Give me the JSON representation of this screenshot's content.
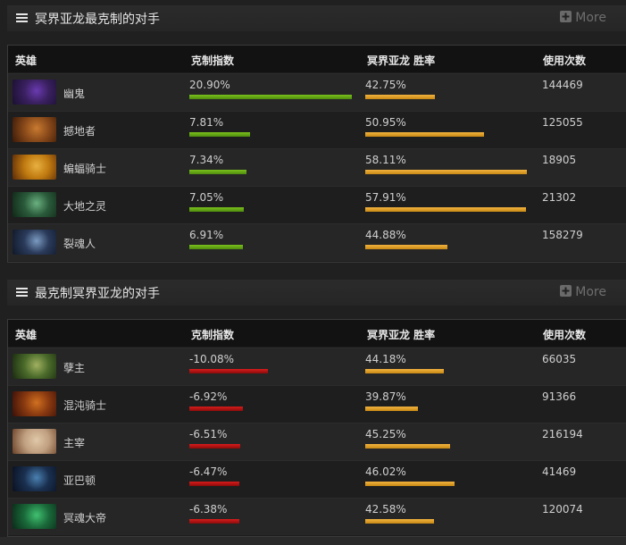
{
  "colors": {
    "advantage_bar": "#6bb015",
    "disadvantage_bar": "#c11414",
    "winrate_bar": "#e8a32b",
    "header_bg": "#121212",
    "page_bg": "#202020"
  },
  "sections": [
    {
      "title": "冥界亚龙最克制的对手",
      "more_label": "More",
      "columns": [
        "英雄",
        "克制指数",
        "冥界亚龙 胜率",
        "使用次数"
      ],
      "bar_type": "advantage",
      "rows": [
        {
          "hero": "幽鬼",
          "advantage": "20.90%",
          "advantage_value": 20.9,
          "winrate": "42.75%",
          "winrate_value": 42.75,
          "matches": "144469",
          "avatar_colors": [
            "#3a2060",
            "#6a3ab0",
            "#1a1030"
          ]
        },
        {
          "hero": "撼地者",
          "advantage": "7.81%",
          "advantage_value": 7.81,
          "winrate": "50.95%",
          "winrate_value": 50.95,
          "matches": "125055",
          "avatar_colors": [
            "#8a4a1a",
            "#c87a30",
            "#3a1a08"
          ]
        },
        {
          "hero": "蝙蝠骑士",
          "advantage": "7.34%",
          "advantage_value": 7.34,
          "winrate": "58.11%",
          "winrate_value": 58.11,
          "matches": "18905",
          "avatar_colors": [
            "#c07a10",
            "#e8b040",
            "#5a2a08"
          ]
        },
        {
          "hero": "大地之灵",
          "advantage": "7.05%",
          "advantage_value": 7.05,
          "winrate": "57.91%",
          "winrate_value": 57.91,
          "matches": "21302",
          "avatar_colors": [
            "#2a5a3a",
            "#6ab080",
            "#102818"
          ]
        },
        {
          "hero": "裂魂人",
          "advantage": "6.91%",
          "advantage_value": 6.91,
          "winrate": "44.88%",
          "winrate_value": 44.88,
          "matches": "158279",
          "avatar_colors": [
            "#2a3a5a",
            "#7a9ac0",
            "#101828"
          ]
        }
      ]
    },
    {
      "title": "最克制冥界亚龙的对手",
      "more_label": "More",
      "columns": [
        "英雄",
        "克制指数",
        "冥界亚龙 胜率",
        "使用次数"
      ],
      "bar_type": "disadvantage",
      "rows": [
        {
          "hero": "孽主",
          "advantage": "-10.08%",
          "advantage_value": -10.08,
          "winrate": "44.18%",
          "winrate_value": 44.18,
          "matches": "66035",
          "avatar_colors": [
            "#4a6a2a",
            "#a0b060",
            "#1a2a10"
          ]
        },
        {
          "hero": "混沌骑士",
          "advantage": "-6.92%",
          "advantage_value": -6.92,
          "winrate": "39.87%",
          "winrate_value": 39.87,
          "matches": "91366",
          "avatar_colors": [
            "#8a3a10",
            "#d07020",
            "#3a1008"
          ]
        },
        {
          "hero": "主宰",
          "advantage": "-6.51%",
          "advantage_value": -6.51,
          "winrate": "45.25%",
          "winrate_value": 45.25,
          "matches": "216194",
          "avatar_colors": [
            "#c0a080",
            "#e0c8a8",
            "#6a4028"
          ]
        },
        {
          "hero": "亚巴顿",
          "advantage": "-6.47%",
          "advantage_value": -6.47,
          "winrate": "46.02%",
          "winrate_value": 46.02,
          "matches": "41469",
          "avatar_colors": [
            "#1a3050",
            "#4a80b0",
            "#0a1020"
          ]
        },
        {
          "hero": "冥魂大帝",
          "advantage": "-6.38%",
          "advantage_value": -6.38,
          "winrate": "42.58%",
          "winrate_value": 42.58,
          "matches": "120074",
          "avatar_colors": [
            "#1a6a3a",
            "#40c070",
            "#0a2a18"
          ]
        }
      ]
    }
  ]
}
